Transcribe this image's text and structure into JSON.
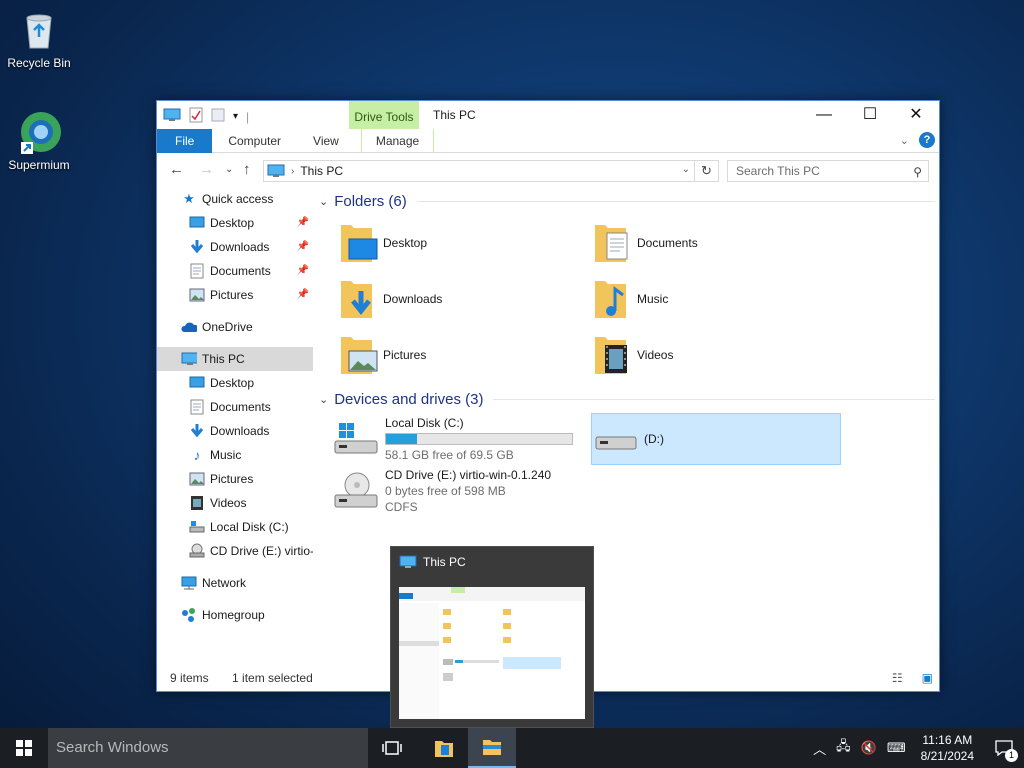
{
  "desktop": {
    "icons": [
      {
        "label": "Recycle Bin"
      },
      {
        "label": "Supermium"
      }
    ]
  },
  "window": {
    "title": "This PC",
    "context_tab": "Drive Tools",
    "ribbon_tabs": [
      "File",
      "Computer",
      "View",
      "Manage"
    ],
    "address_path": "This PC",
    "search_placeholder": "Search This PC",
    "nav": {
      "quick_access": "Quick access",
      "qa_items": [
        "Desktop",
        "Downloads",
        "Documents",
        "Pictures"
      ],
      "onedrive": "OneDrive",
      "this_pc": "This PC",
      "pc_items": [
        "Desktop",
        "Documents",
        "Downloads",
        "Music",
        "Pictures",
        "Videos",
        "Local Disk (C:)",
        "CD Drive (E:) virtio-win-0.1.240"
      ],
      "network": "Network",
      "homegroup": "Homegroup"
    },
    "folders_header": "Folders (6)",
    "folders": [
      "Desktop",
      "Documents",
      "Downloads",
      "Music",
      "Pictures",
      "Videos"
    ],
    "devices_header": "Devices and drives (3)",
    "drives": {
      "c": {
        "name": "Local Disk (C:)",
        "free": "58.1 GB free of 69.5 GB",
        "used_fraction": 0.164
      },
      "d": {
        "name": "(D:)"
      },
      "e": {
        "name": "CD Drive (E:) virtio-win-0.1.240",
        "free": "0 bytes free of 598 MB",
        "fs": "CDFS"
      }
    },
    "status": {
      "items": "9 items",
      "selected": "1 item selected"
    }
  },
  "thumbnail": {
    "title": "This PC"
  },
  "taskbar": {
    "search_placeholder": "Search Windows",
    "time": "11:16 AM",
    "date": "8/21/2024",
    "notification_count": "1"
  },
  "colors": {
    "accent": "#1979ca",
    "selection": "#cce8ff",
    "context": "#c6efa5"
  }
}
